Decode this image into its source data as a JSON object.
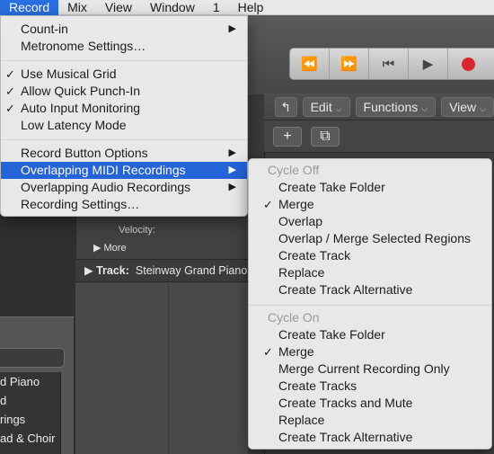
{
  "menubar": {
    "items": [
      "Record",
      "Mix",
      "View",
      "Window",
      "1",
      "Help"
    ]
  },
  "record_menu": {
    "count_in": "Count-in",
    "metronome_settings": "Metronome Settings…",
    "use_musical_grid": "Use Musical Grid",
    "allow_quick_punch_in": "Allow Quick Punch-In",
    "auto_input_monitoring": "Auto Input Monitoring",
    "low_latency_mode": "Low Latency Mode",
    "record_button_options": "Record Button Options",
    "overlapping_midi": "Overlapping MIDI Recordings",
    "overlapping_audio": "Overlapping Audio Recordings",
    "recording_settings": "Recording Settings…"
  },
  "submenu": {
    "cycle_off_header": "Cycle Off",
    "cycle_off_items": [
      "Create Take Folder",
      "Merge",
      "Overlap",
      "Overlap / Merge Selected Regions",
      "Create Track",
      "Replace",
      "Create Track Alternative"
    ],
    "cycle_on_header": "Cycle On",
    "cycle_on_items": [
      "Create Take Folder",
      "Merge",
      "Merge Current Recording Only",
      "Create Tracks",
      "Create Tracks and Mute",
      "Replace",
      "Create Track Alternative"
    ]
  },
  "toolbar": {
    "edit": "Edit",
    "functions": "Functions",
    "view": "View"
  },
  "inspector": {
    "velocity_label": "Velocity:",
    "more_label": "More",
    "track_label": "Track:",
    "track_name": "Steinway Grand Piano"
  },
  "track_list": [
    "d Piano",
    "d",
    "rings",
    "ad & Choir"
  ],
  "colors": {
    "highlight": "#2563d8",
    "record_button": "#d8262e"
  }
}
